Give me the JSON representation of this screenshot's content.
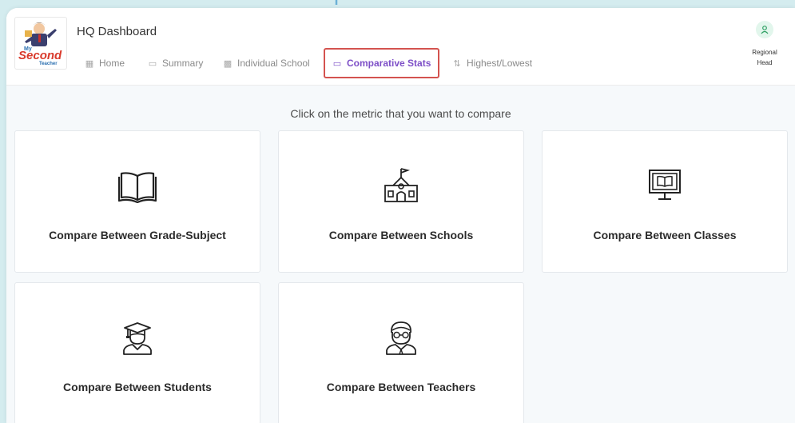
{
  "header": {
    "app_title": "HQ Dashboard",
    "logo_text": "My Second Teacher"
  },
  "nav": {
    "items": [
      {
        "label": "Home",
        "icon": "grid-icon"
      },
      {
        "label": "Summary",
        "icon": "chat-icon"
      },
      {
        "label": "Individual School",
        "icon": "chart-icon"
      },
      {
        "label": "Comparative Stats",
        "icon": "chat-icon",
        "active": true
      },
      {
        "label": "Highest/Lowest",
        "icon": "sort-icon"
      }
    ]
  },
  "user": {
    "role_line1": "Regional",
    "role_line2": "Head",
    "icon": "user-icon"
  },
  "main": {
    "prompt": "Click on the metric that you want to compare",
    "cards": [
      {
        "title": "Compare Between Grade-Subject",
        "icon": "book-icon"
      },
      {
        "title": "Compare Between Schools",
        "icon": "school-icon"
      },
      {
        "title": "Compare Between Classes",
        "icon": "classroom-monitor-icon"
      },
      {
        "title": "Compare Between Students",
        "icon": "student-icon"
      },
      {
        "title": "Compare Between Teachers",
        "icon": "teacher-icon"
      }
    ]
  },
  "colors": {
    "background": "#d4ecef",
    "active_nav": "#7d4fc7",
    "highlight_border": "#d4534f",
    "arrow": "#6bb0d6",
    "avatar_bg": "#e2f6ec"
  }
}
